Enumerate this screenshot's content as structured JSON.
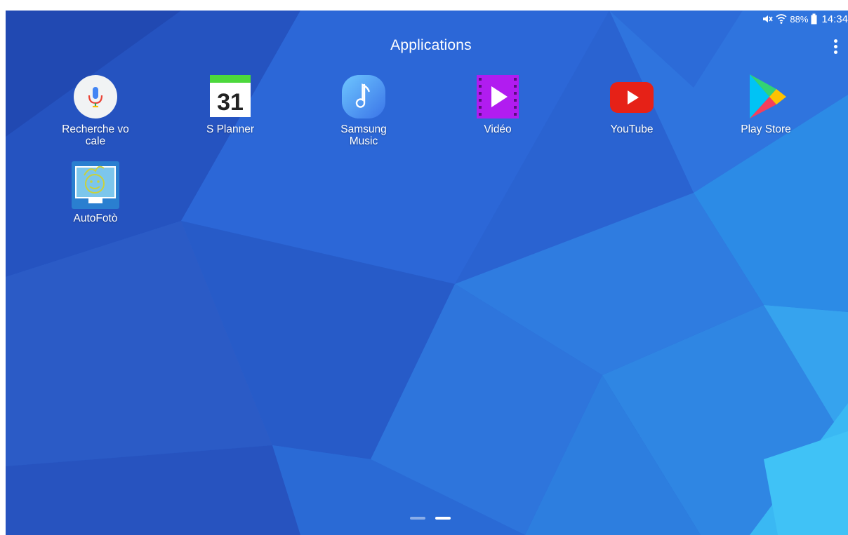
{
  "status_bar": {
    "mute_icon": "mute-icon",
    "wifi_icon": "wifi-icon",
    "battery_percent": "88%",
    "battery_icon": "battery-icon",
    "time": "14:34"
  },
  "header": {
    "title": "Applications",
    "menu_icon": "more-vertical-icon"
  },
  "apps": [
    {
      "label": "Recherche vo\ncale",
      "icon": "microphone-icon"
    },
    {
      "label": "S Planner",
      "icon": "calendar-icon",
      "date": "31"
    },
    {
      "label": "Samsung\nMusic",
      "icon": "music-note-icon"
    },
    {
      "label": "Vidéo",
      "icon": "video-play-icon"
    },
    {
      "label": "YouTube",
      "icon": "youtube-icon"
    },
    {
      "label": "Play Store",
      "icon": "play-store-icon"
    },
    {
      "label": "AutoFotò",
      "icon": "autofoto-icon"
    }
  ],
  "page_indicator": {
    "pages": 2,
    "active_page": 2
  },
  "colors": {
    "wallpaper_dark": "#1f4fb4",
    "wallpaper_light": "#35b3f2",
    "youtube_red": "#e62117",
    "video_purple": "#b11cf0",
    "calendar_green": "#4cd83c"
  }
}
